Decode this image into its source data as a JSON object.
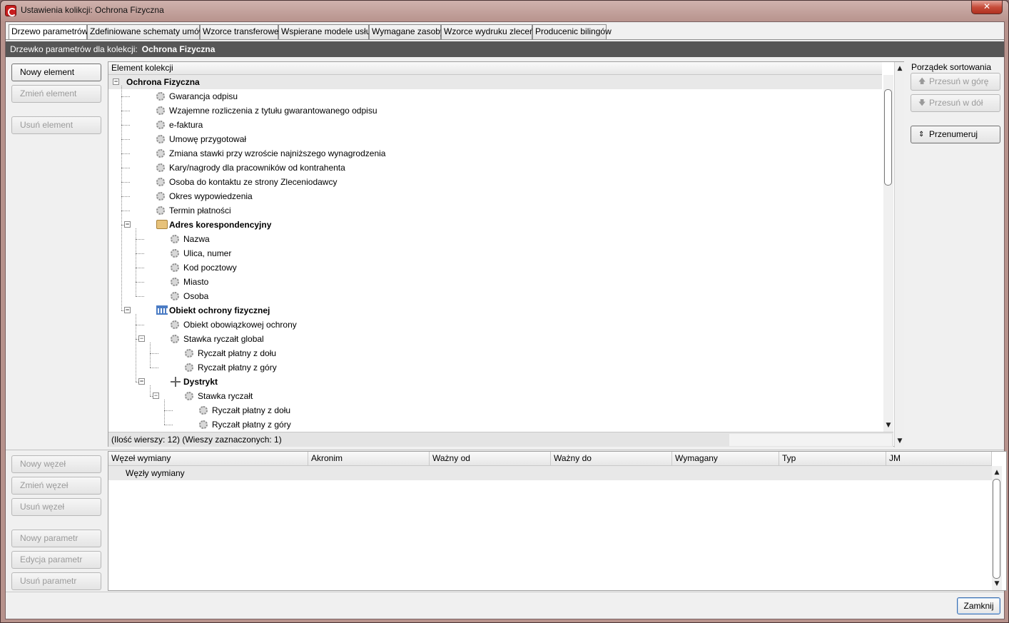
{
  "window": {
    "title": "Ustawienia kolikcji: Ochrona Fizyczna",
    "close_glyph": "✕"
  },
  "tabs": [
    {
      "label": "Drzewo parametrów",
      "active": true
    },
    {
      "label": "Zdefiniowane schematy umów"
    },
    {
      "label": "Wzorce transferowe"
    },
    {
      "label": "Wspierane modele usług"
    },
    {
      "label": "Wymagane zasoby"
    },
    {
      "label": "Wzorce wydruku zleceń"
    },
    {
      "label": "Producenic bilingów"
    }
  ],
  "header": {
    "label": "Drzewko parametrów dla kolekcji:",
    "collection": "Ochrona Fizyczna"
  },
  "left_buttons": {
    "new_element": "Nowy element",
    "edit_element": "Zmień element",
    "delete_element": "Usuń element",
    "new_node": "Nowy węzeł",
    "edit_node": "Zmień węzeł",
    "delete_node": "Usuń węzeł",
    "new_param": "Nowy parametr",
    "edit_param": "Edycja parametr",
    "delete_param": "Usuń parametr"
  },
  "tree": {
    "column": "Element kolekcji",
    "rows": [
      {
        "label": "Ochrona Fizyczna",
        "depth": 0,
        "type": "root"
      },
      {
        "label": "Gwarancja odpisu",
        "depth": 1,
        "type": "param"
      },
      {
        "label": "Wzajemne rozliczenia z tytułu gwarantowanego odpisu",
        "depth": 1,
        "type": "param"
      },
      {
        "label": "e-faktura",
        "depth": 1,
        "type": "param"
      },
      {
        "label": "Umowę przygotował",
        "depth": 1,
        "type": "param"
      },
      {
        "label": "Zmiana stawki przy wzroście najniższego wynagrodzenia",
        "depth": 1,
        "type": "param"
      },
      {
        "label": "Kary/nagrody dla pracowników od kontrahenta",
        "depth": 1,
        "type": "param"
      },
      {
        "label": "Osoba do kontaktu ze strony Zleceniodawcy",
        "depth": 1,
        "type": "param"
      },
      {
        "label": "Okres wypowiedzenia",
        "depth": 1,
        "type": "param"
      },
      {
        "label": "Termin płatności",
        "depth": 1,
        "type": "param"
      },
      {
        "label": "Adres korespondencyjny",
        "depth": 1,
        "type": "folder"
      },
      {
        "label": "Nazwa",
        "depth": 2,
        "type": "param"
      },
      {
        "label": "Ulica, numer",
        "depth": 2,
        "type": "param"
      },
      {
        "label": "Kod pocztowy",
        "depth": 2,
        "type": "param"
      },
      {
        "label": "Miasto",
        "depth": 2,
        "type": "param"
      },
      {
        "label": "Osoba",
        "depth": 2,
        "type": "param"
      },
      {
        "label": "Obiekt ochrony fizycznej",
        "depth": 1,
        "type": "bank"
      },
      {
        "label": "Obiekt obowiązkowej ochrony",
        "depth": 2,
        "type": "param"
      },
      {
        "label": "Stawka ryczałt global",
        "depth": 2,
        "type": "param-exp"
      },
      {
        "label": "Ryczałt płatny z dołu",
        "depth": 3,
        "type": "param"
      },
      {
        "label": "Ryczałt płatny z góry",
        "depth": 3,
        "type": "param"
      },
      {
        "label": "Dystrykt",
        "depth": 2,
        "type": "grid"
      },
      {
        "label": "Stawka ryczałt",
        "depth": 3,
        "type": "param-exp"
      },
      {
        "label": "Ryczałt płatny z dołu",
        "depth": 4,
        "type": "param"
      },
      {
        "label": "Ryczałt płatny z góry",
        "depth": 4,
        "type": "param"
      }
    ],
    "status": "(Ilość wierszy: 12)  (Wieszy zaznaczonych: 1)"
  },
  "sort": {
    "title": "Porządek sortowania",
    "move_up": "Przesuń w górę",
    "move_down": "Przesuń w dół",
    "renumber": "Przenumeruj"
  },
  "nodes_table": {
    "columns": [
      "Węzeł wymiany",
      "Akronim",
      "Ważny od",
      "Ważny do",
      "Wymagany",
      "Typ",
      "JM"
    ],
    "group_row": "Węzły wymiany"
  },
  "footer": {
    "close": "Zamknij"
  }
}
